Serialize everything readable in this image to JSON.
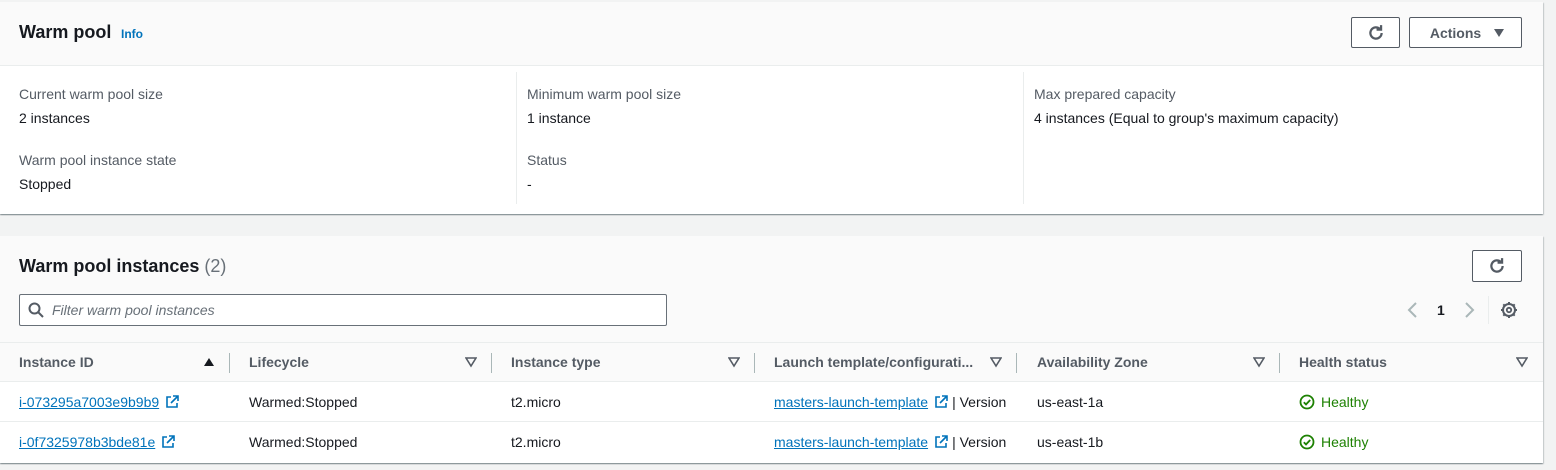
{
  "warm_pool": {
    "title": "Warm pool",
    "info_label": "Info",
    "actions_label": "Actions",
    "details": {
      "current_size_label": "Current warm pool size",
      "current_size_value": "2 instances",
      "min_size_label": "Minimum warm pool size",
      "min_size_value": "1 instance",
      "max_capacity_label": "Max prepared capacity",
      "max_capacity_value": "4 instances (Equal to group's maximum capacity)",
      "instance_state_label": "Warm pool instance state",
      "instance_state_value": "Stopped",
      "status_label": "Status",
      "status_value": "-"
    }
  },
  "instances": {
    "title": "Warm pool instances",
    "count": "(2)",
    "search_placeholder": "Filter warm pool instances",
    "page_number": "1",
    "columns": [
      {
        "label": "Instance ID",
        "sort": "ascending"
      },
      {
        "label": "Lifecycle",
        "sort": "none"
      },
      {
        "label": "Instance type",
        "sort": "none"
      },
      {
        "label": "Launch template/configurati...",
        "sort": "none"
      },
      {
        "label": "Availability Zone",
        "sort": "none"
      },
      {
        "label": "Health status",
        "sort": "none"
      }
    ],
    "rows": [
      {
        "instance_id": "i-073295a7003e9b9b9",
        "lifecycle": "Warmed:Stopped",
        "instance_type": "t2.micro",
        "launch_template": "masters-launch-template",
        "version": "| Version",
        "az": "us-east-1a",
        "health": "Healthy"
      },
      {
        "instance_id": "i-0f7325978b3bde81e",
        "lifecycle": "Warmed:Stopped",
        "instance_type": "t2.micro",
        "launch_template": "masters-launch-template",
        "version": "| Version",
        "az": "us-east-1b",
        "health": "Healthy"
      }
    ]
  },
  "colors": {
    "link": "#0073bb",
    "healthy": "#1d8102",
    "text": "#16191f",
    "label": "#545b64"
  },
  "icons": [
    "refresh-icon",
    "caret-down-icon",
    "search-icon",
    "chevron-left-icon",
    "chevron-right-icon",
    "gear-icon",
    "sort-ascending-icon",
    "sort-caret-icon",
    "external-link-icon",
    "check-circle-icon"
  ]
}
